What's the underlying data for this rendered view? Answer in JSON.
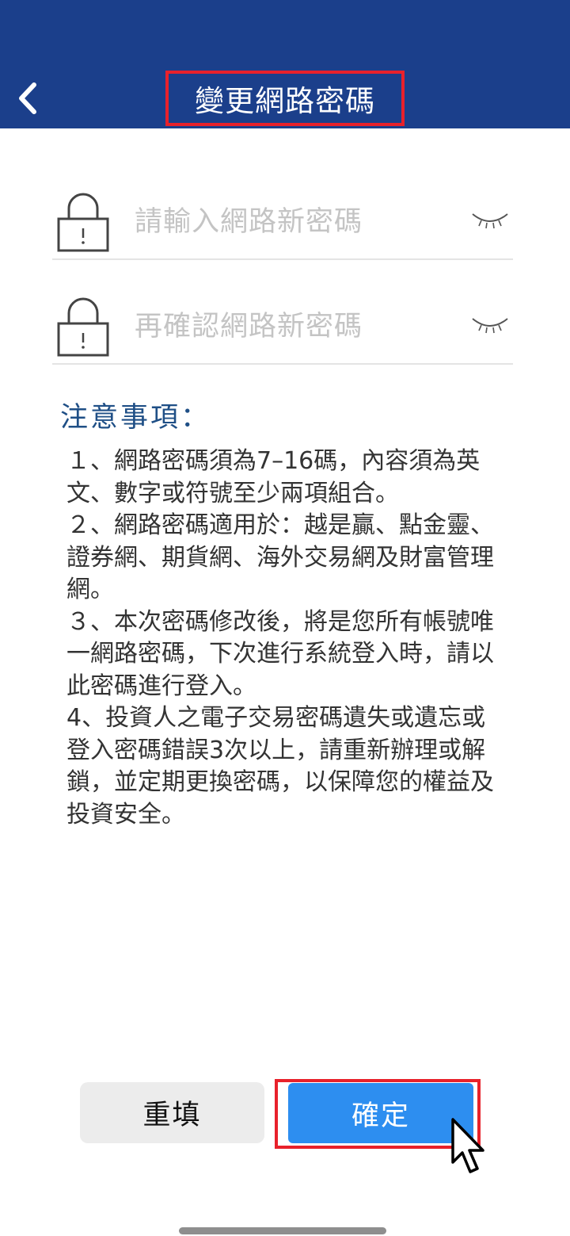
{
  "header": {
    "title": "變更網路密碼",
    "back_icon": "chevron-left-icon",
    "background_color": "#1b3f8b",
    "highlight_color": "#e8212b"
  },
  "form": {
    "new_password": {
      "placeholder": "請輸入網路新密碼",
      "value": "",
      "lock_icon": "lock-icon",
      "visibility_icon": "eye-closed-icon"
    },
    "confirm_password": {
      "placeholder": "再確認網路新密碼",
      "value": "",
      "lock_icon": "lock-icon",
      "visibility_icon": "eye-closed-icon"
    }
  },
  "notice": {
    "title": "注意事項：",
    "items": [
      "１、網路密碼須為7–16碼，內容須為英文、數字或符號至少兩項組合。",
      "２、網路密碼適用於：越是贏、點金靈、證券網、期貨網、海外交易網及財富管理網。",
      "３、本次密碼修改後，將是您所有帳號唯一網路密碼，下次進行系統登入時，請以此密碼進行登入。",
      "4、投資人之電子交易密碼遺失或遺忘或登入密碼錯誤3次以上，請重新辦理或解鎖，並定期更換密碼，以保障您的權益及投資安全。"
    ]
  },
  "actions": {
    "reset_label": "重填",
    "confirm_label": "確定",
    "confirm_color": "#2d8ef0",
    "pointer_icon": "mouse-pointer-icon"
  }
}
